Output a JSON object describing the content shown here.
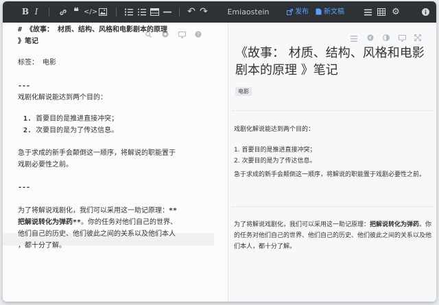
{
  "toolbar": {
    "bold_label": "B",
    "italic_label": "I",
    "title": "Emiaostein",
    "publish_label": "发布",
    "new_doc_label": "新文稿"
  },
  "editor": {
    "heading_line1": "# 《故事： 材质、结构、风格和电影剧本的原理",
    "heading_line2": "》笔记",
    "tags_line": "标签：  电影",
    "rule1": "---",
    "intro": "戏剧化解说能达到两个目的：",
    "item1_num": "1.",
    "item1_text": "首要目的是推进直接冲突；",
    "item2_num": "2.",
    "item2_text": "次要目的是为了传达信息。",
    "para_line1": "急于求成的新手会颠倒这一顺序，将解说的职能置于",
    "para_line2": "戏剧必要性之前。",
    "rule2": "---",
    "p2_line1a": "为了将解说戏剧化，我们可以采用这一助记原理：",
    "p2_line1b": "**",
    "p2_line2a": "把解说转化为弹药**",
    "p2_line2b": "。你的任务对他们自己的世界、",
    "p2_line3": "他们自己的历史、他们彼此之间的关系以及他们本人",
    "p2_line4": "，都十分了解。"
  },
  "preview": {
    "title": "《故事： 材质、结构、风格和电影剧本的原理 》笔记",
    "tag": "电影",
    "intro": "戏剧化解说能达到两个目的：",
    "item1": "1.  首要目的是推进直接冲突；",
    "item2": "2.  次要目的是为了传达信息。",
    "para": "急于求成的新手会颠倒这一顺序，将解说的职能置于戏剧必要性之前。",
    "p2_a": "为了将解说戏剧化，我们可以采用这一助记原理：",
    "p2_bold": "把解说转化为弹药",
    "p2_b": "。你的任务对他们自己的世界、他们自己的历史、他们彼此之间的关系以及他们本人，都十分了解。"
  },
  "colors": {
    "toolbar_bg": "#2e3237",
    "accent": "#5aa0ff"
  }
}
